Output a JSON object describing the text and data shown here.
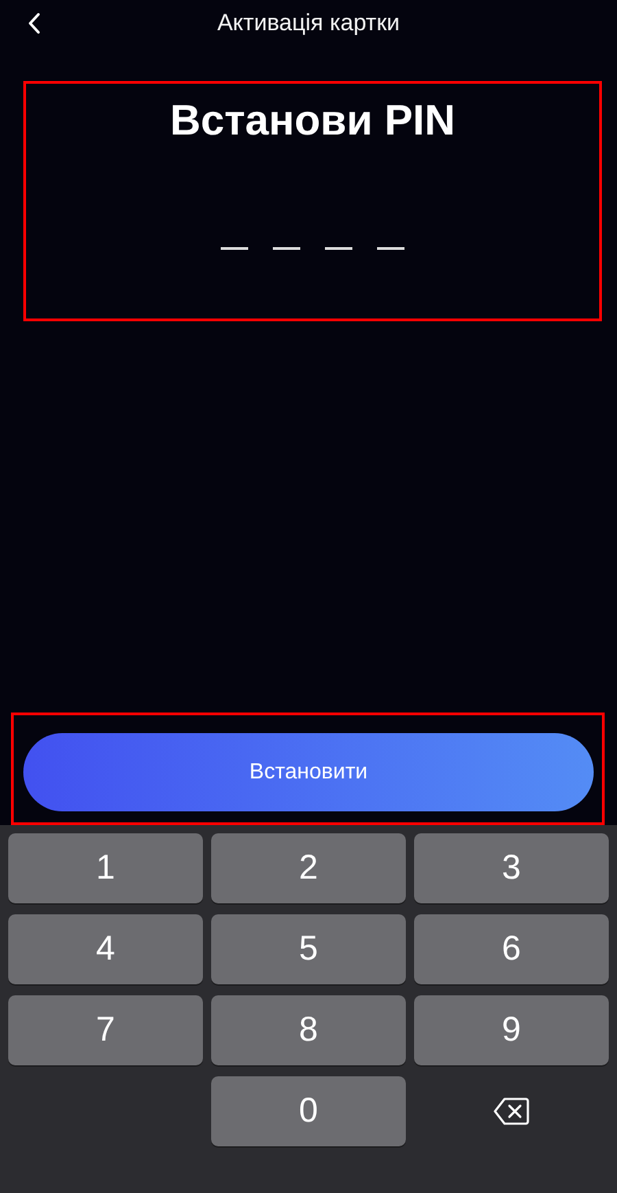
{
  "header": {
    "title": "Активація картки"
  },
  "pin_section": {
    "highlighted": true,
    "title": "Встанови PIN",
    "slots": [
      {
        "filled": false
      },
      {
        "filled": false
      },
      {
        "filled": false
      },
      {
        "filled": false
      }
    ]
  },
  "action_section": {
    "highlighted": true,
    "button": "Встановити"
  },
  "keypad": [
    {
      "kind": "digit",
      "label": "1"
    },
    {
      "kind": "digit",
      "label": "2"
    },
    {
      "kind": "digit",
      "label": "3"
    },
    {
      "kind": "digit",
      "label": "4"
    },
    {
      "kind": "digit",
      "label": "5"
    },
    {
      "kind": "digit",
      "label": "6"
    },
    {
      "kind": "digit",
      "label": "7"
    },
    {
      "kind": "digit",
      "label": "8"
    },
    {
      "kind": "digit",
      "label": "9"
    },
    {
      "kind": "blank"
    },
    {
      "kind": "digit",
      "label": "0"
    },
    {
      "kind": "backspace"
    }
  ]
}
